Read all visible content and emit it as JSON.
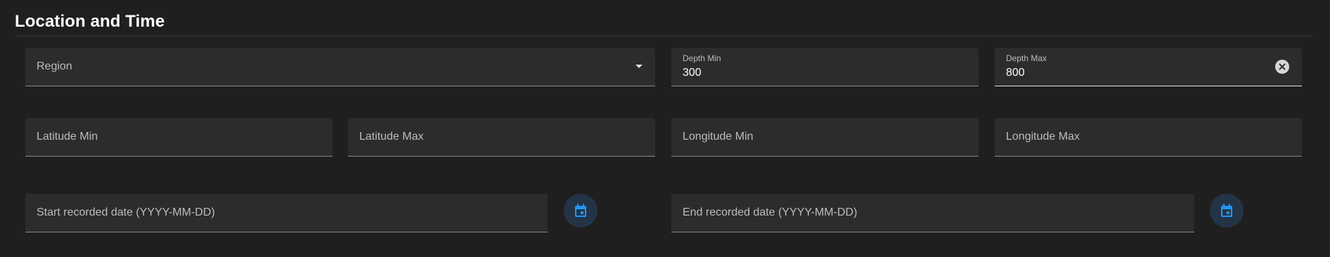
{
  "section": {
    "title": "Location and Time"
  },
  "fields": {
    "region": {
      "placeholder": "Region"
    },
    "depth_min": {
      "label": "Depth Min",
      "value": "300"
    },
    "depth_max": {
      "label": "Depth Max",
      "value": "800"
    },
    "latitude_min": {
      "placeholder": "Latitude Min"
    },
    "latitude_max": {
      "placeholder": "Latitude Max"
    },
    "longitude_min": {
      "placeholder": "Longitude Min"
    },
    "longitude_max": {
      "placeholder": "Longitude Max"
    },
    "start_date": {
      "placeholder": "Start recorded date (YYYY-MM-DD)"
    },
    "end_date": {
      "placeholder": "End recorded date (YYYY-MM-DD)"
    }
  },
  "icons": {
    "dropdown": "chevron-down-icon",
    "clear": "clear-icon",
    "calendar": "calendar-icon"
  },
  "colors": {
    "background": "#1f1f1f",
    "field_background": "#2c2c2c",
    "calendar_accent": "#2196f3",
    "calendar_button_bg": "#243447"
  }
}
